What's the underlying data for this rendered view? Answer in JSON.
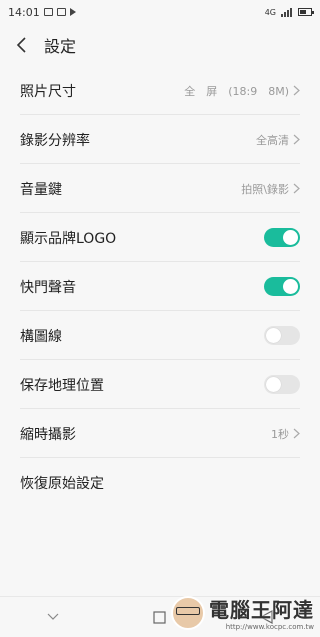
{
  "status_bar": {
    "time": "14:01",
    "signal": "4G"
  },
  "header": {
    "title": "設定"
  },
  "settings": [
    {
      "label": "照片尺寸",
      "value": "全　屏　(18:9　8M)",
      "type": "chevron"
    },
    {
      "label": "錄影分辨率",
      "value": "全高清",
      "type": "chevron"
    },
    {
      "label": "音量鍵",
      "value": "拍照\\錄影",
      "type": "chevron"
    },
    {
      "label": "顯示品牌LOGO",
      "type": "toggle",
      "on": true
    },
    {
      "label": "快門聲音",
      "type": "toggle",
      "on": true
    },
    {
      "label": "構圖線",
      "type": "toggle",
      "on": false
    },
    {
      "label": "保存地理位置",
      "type": "toggle",
      "on": false
    },
    {
      "label": "縮時攝影",
      "value": "1秒",
      "type": "chevron"
    },
    {
      "label": "恢復原始設定",
      "type": "plain"
    }
  ],
  "colors": {
    "toggle_on": "#1abc9c",
    "toggle_off": "#e5e5e5",
    "background": "#f7f7f7"
  },
  "nav_icons": [
    "chevron-down-icon",
    "square-icon",
    "back-triangle-icon"
  ],
  "watermark": {
    "brand": "電腦王阿達",
    "url": "http://www.kocpc.com.tw"
  }
}
